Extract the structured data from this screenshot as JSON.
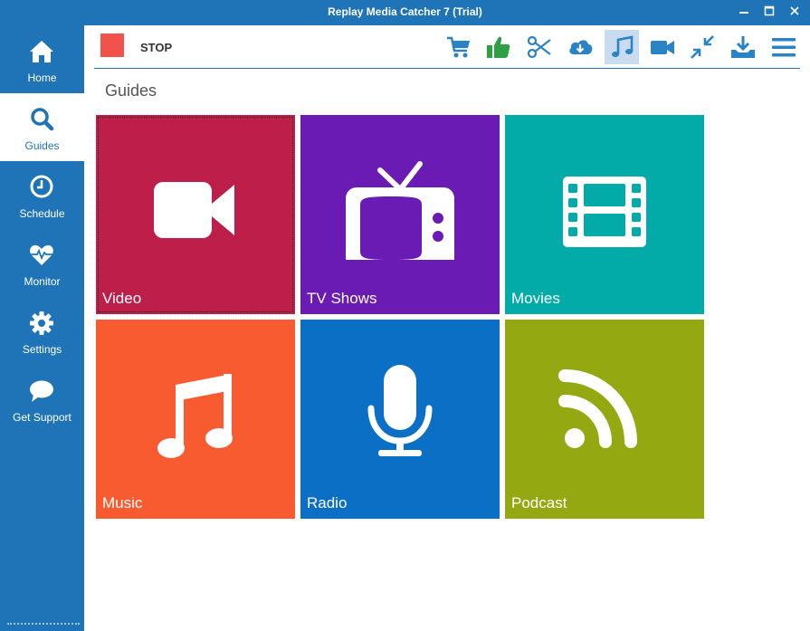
{
  "window": {
    "title": "Replay Media Catcher 7 (Trial)",
    "controls": [
      "minimize",
      "maximize",
      "close"
    ]
  },
  "sidebar": {
    "items": [
      {
        "label": "Home",
        "icon": "home-icon",
        "active": false
      },
      {
        "label": "Guides",
        "icon": "search-icon",
        "active": true
      },
      {
        "label": "Schedule",
        "icon": "clock-icon",
        "active": false
      },
      {
        "label": "Monitor",
        "icon": "heartbeat-icon",
        "active": false
      },
      {
        "label": "Settings",
        "icon": "gear-icon",
        "active": false
      },
      {
        "label": "Get Support",
        "icon": "chat-bubble-icon",
        "active": false
      }
    ]
  },
  "toolbar": {
    "stop_label": "STOP",
    "tools": [
      {
        "icon": "cart-icon"
      },
      {
        "icon": "thumbs-up-icon"
      },
      {
        "icon": "scissors-icon"
      },
      {
        "icon": "cloud-download-icon"
      },
      {
        "icon": "music-note-icon",
        "active": true
      },
      {
        "icon": "video-camera-icon"
      },
      {
        "icon": "compress-icon"
      },
      {
        "icon": "download-tray-icon"
      },
      {
        "icon": "hamburger-menu-icon"
      }
    ]
  },
  "main": {
    "section_title": "Guides",
    "tiles": [
      {
        "label": "Video",
        "icon": "video-camera-icon",
        "color": "#be1e4a"
      },
      {
        "label": "TV Shows",
        "icon": "tv-icon",
        "color": "#6a1bb4"
      },
      {
        "label": "Movies",
        "icon": "film-strip-icon",
        "color": "#02aaa8"
      },
      {
        "label": "Music",
        "icon": "music-note-icon",
        "color": "#f85b30"
      },
      {
        "label": "Radio",
        "icon": "microphone-icon",
        "color": "#0a6fc5"
      },
      {
        "label": "Podcast",
        "icon": "rss-icon",
        "color": "#94a911"
      }
    ]
  },
  "colors": {
    "brand_blue": "#1f74b7",
    "stop_red": "#f2524a",
    "thumbs_green": "#2ea043",
    "toolbar_icon_blue": "#2a83c6",
    "active_tool_bg": "#c9dcef"
  }
}
